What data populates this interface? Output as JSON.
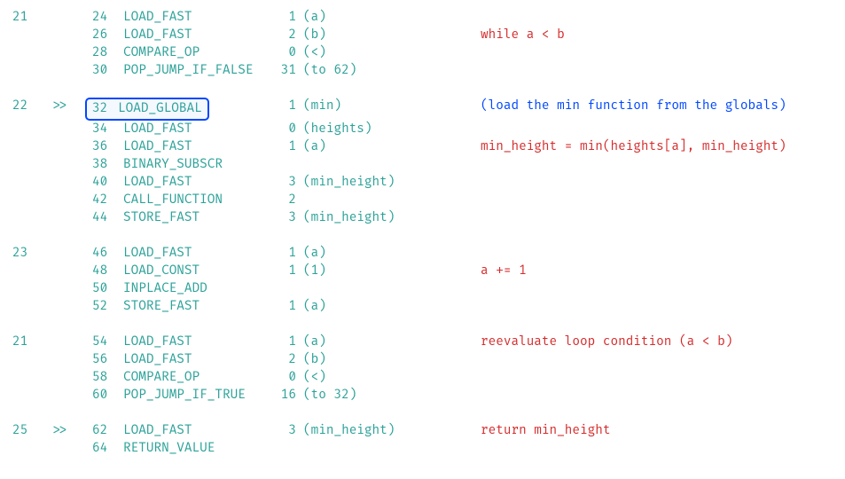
{
  "rows": [
    {
      "line": "21",
      "marker": "",
      "offset": "24",
      "op": "LOAD_FAST",
      "arg": "1",
      "repr": "(a)",
      "annot": "",
      "annot_color": "",
      "highlight": false
    },
    {
      "line": "",
      "marker": "",
      "offset": "26",
      "op": "LOAD_FAST",
      "arg": "2",
      "repr": "(b)",
      "annot": "while a < b",
      "annot_color": "red",
      "highlight": false
    },
    {
      "line": "",
      "marker": "",
      "offset": "28",
      "op": "COMPARE_OP",
      "arg": "0",
      "repr": "(<)",
      "annot": "",
      "annot_color": "",
      "highlight": false
    },
    {
      "line": "",
      "marker": "",
      "offset": "30",
      "op": "POP_JUMP_IF_FALSE",
      "arg": "31",
      "repr": "(to 62)",
      "annot": "",
      "annot_color": "",
      "highlight": false
    },
    {
      "blank": true
    },
    {
      "line": "22",
      "marker": ">>",
      "offset": "32",
      "op": "LOAD_GLOBAL",
      "arg": "1",
      "repr": "(min)",
      "annot": " (load the min function from the globals)",
      "annot_color": "blue",
      "highlight": true
    },
    {
      "line": "",
      "marker": "",
      "offset": "34",
      "op": "LOAD_FAST",
      "arg": "0",
      "repr": "(heights)",
      "annot": "",
      "annot_color": "",
      "highlight": false
    },
    {
      "line": "",
      "marker": "",
      "offset": "36",
      "op": "LOAD_FAST",
      "arg": "1",
      "repr": "(a)",
      "annot": "min_height = min(heights[a], min_height)",
      "annot_color": "red",
      "highlight": false
    },
    {
      "line": "",
      "marker": "",
      "offset": "38",
      "op": "BINARY_SUBSCR",
      "arg": "",
      "repr": "",
      "annot": "",
      "annot_color": "",
      "highlight": false
    },
    {
      "line": "",
      "marker": "",
      "offset": "40",
      "op": "LOAD_FAST",
      "arg": "3",
      "repr": "(min_height)",
      "annot": "",
      "annot_color": "",
      "highlight": false
    },
    {
      "line": "",
      "marker": "",
      "offset": "42",
      "op": "CALL_FUNCTION",
      "arg": "2",
      "repr": "",
      "annot": "",
      "annot_color": "",
      "highlight": false
    },
    {
      "line": "",
      "marker": "",
      "offset": "44",
      "op": "STORE_FAST",
      "arg": "3",
      "repr": "(min_height)",
      "annot": "",
      "annot_color": "",
      "highlight": false
    },
    {
      "blank": true
    },
    {
      "line": "23",
      "marker": "",
      "offset": "46",
      "op": "LOAD_FAST",
      "arg": "1",
      "repr": "(a)",
      "annot": "",
      "annot_color": "",
      "highlight": false
    },
    {
      "line": "",
      "marker": "",
      "offset": "48",
      "op": "LOAD_CONST",
      "arg": "1",
      "repr": "(1)",
      "annot": " a += 1",
      "annot_color": "red",
      "highlight": false
    },
    {
      "line": "",
      "marker": "",
      "offset": "50",
      "op": "INPLACE_ADD",
      "arg": "",
      "repr": "",
      "annot": "",
      "annot_color": "",
      "highlight": false
    },
    {
      "line": "",
      "marker": "",
      "offset": "52",
      "op": "STORE_FAST",
      "arg": "1",
      "repr": "(a)",
      "annot": "",
      "annot_color": "",
      "highlight": false
    },
    {
      "blank": true
    },
    {
      "line": "21",
      "marker": "",
      "offset": "54",
      "op": "LOAD_FAST",
      "arg": "1",
      "repr": "(a)",
      "annot": " reevaluate loop condition (a < b)",
      "annot_color": "red",
      "highlight": false
    },
    {
      "line": "",
      "marker": "",
      "offset": "56",
      "op": "LOAD_FAST",
      "arg": "2",
      "repr": "(b)",
      "annot": "",
      "annot_color": "",
      "highlight": false
    },
    {
      "line": "",
      "marker": "",
      "offset": "58",
      "op": "COMPARE_OP",
      "arg": "0",
      "repr": "(<)",
      "annot": "",
      "annot_color": "",
      "highlight": false
    },
    {
      "line": "",
      "marker": "",
      "offset": "60",
      "op": "POP_JUMP_IF_TRUE",
      "arg": "16",
      "repr": "(to 32)",
      "annot": "",
      "annot_color": "",
      "highlight": false
    },
    {
      "blank": true
    },
    {
      "line": "25",
      "marker": ">>",
      "offset": "62",
      "op": "LOAD_FAST",
      "arg": "3",
      "repr": "(min_height)",
      "annot": "  return min_height",
      "annot_color": "red",
      "highlight": false
    },
    {
      "line": "",
      "marker": "",
      "offset": "64",
      "op": "RETURN_VALUE",
      "arg": "",
      "repr": "",
      "annot": "",
      "annot_color": "",
      "highlight": false
    }
  ]
}
